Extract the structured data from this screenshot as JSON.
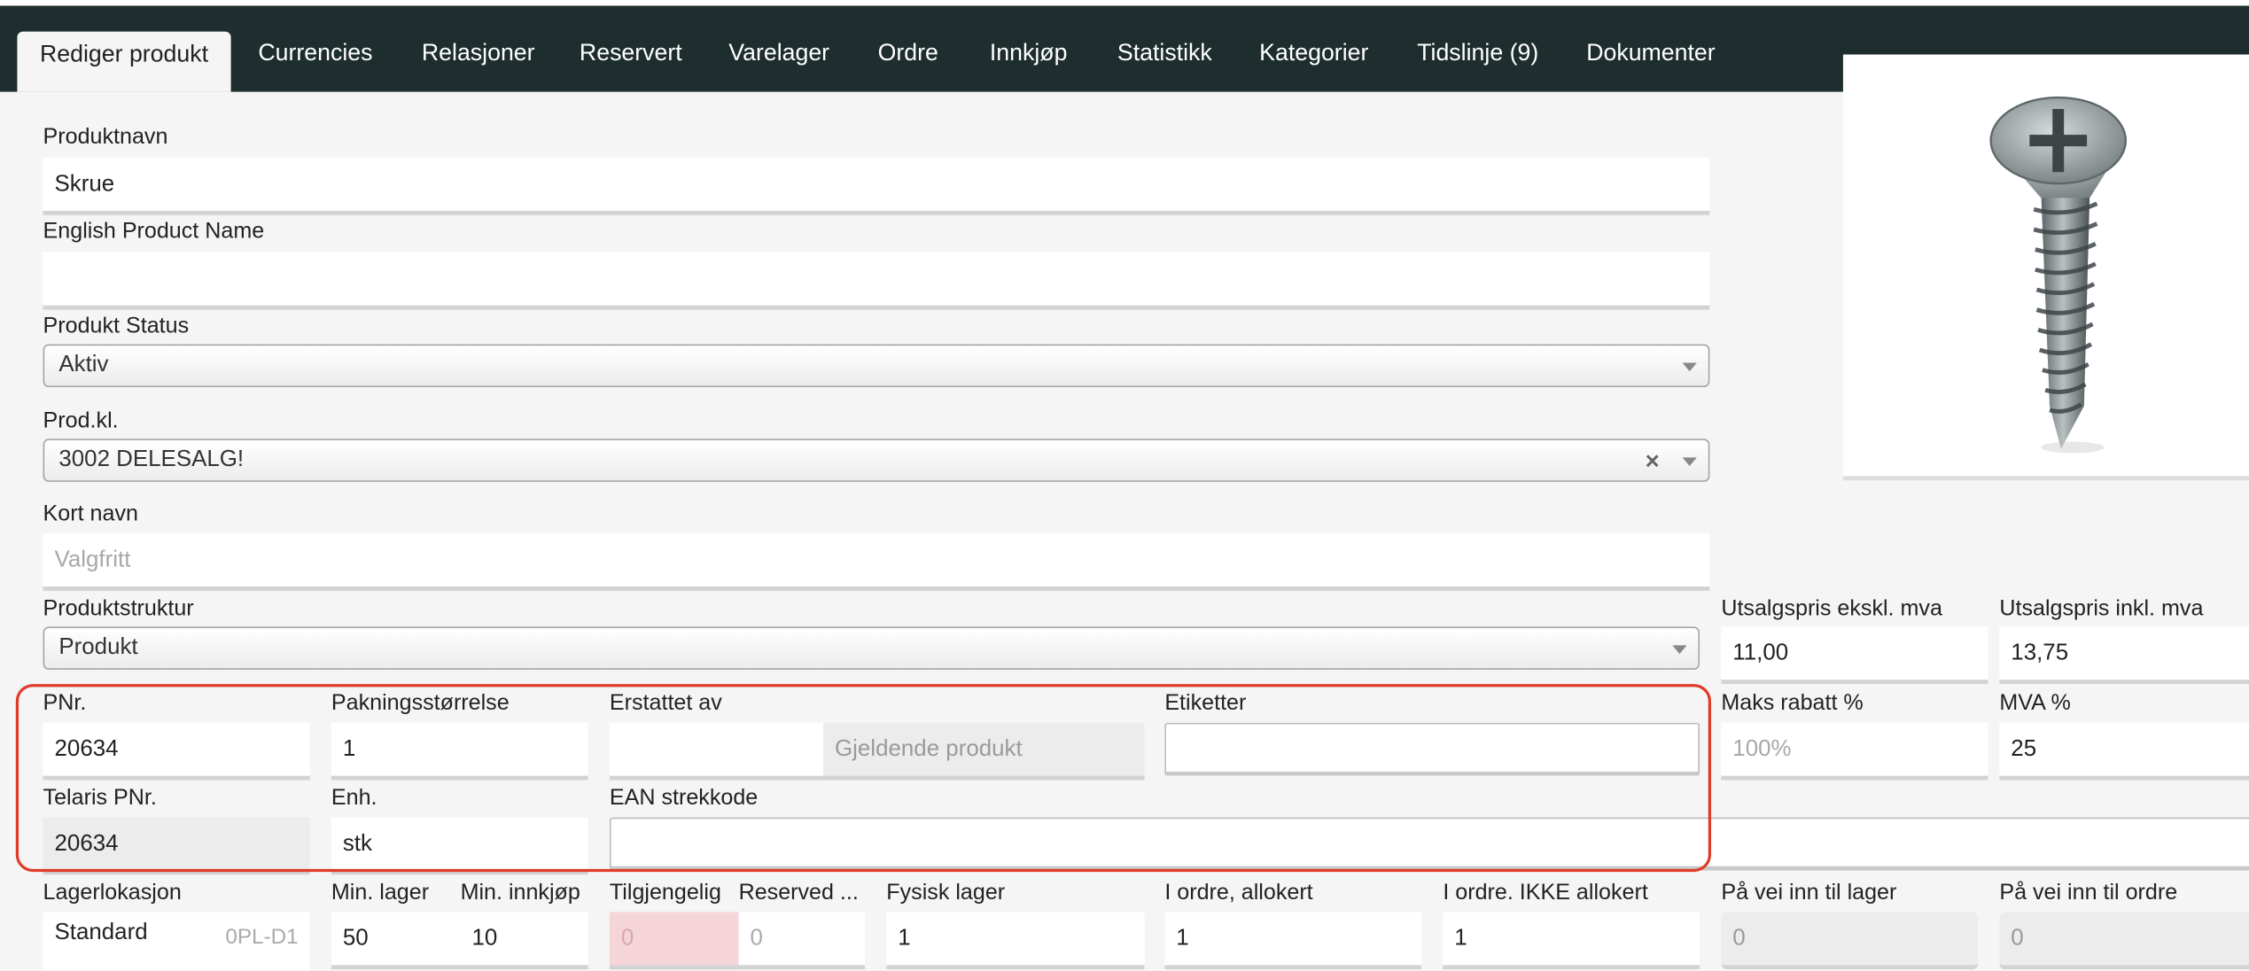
{
  "tabs": [
    {
      "label": "Rediger produkt",
      "active": true
    },
    {
      "label": "Currencies"
    },
    {
      "label": "Relasjoner"
    },
    {
      "label": "Reservert"
    },
    {
      "label": "Varelager"
    },
    {
      "label": "Ordre"
    },
    {
      "label": "Innkjøp"
    },
    {
      "label": "Statistikk"
    },
    {
      "label": "Kategorier"
    },
    {
      "label": "Tidslinje (9)"
    },
    {
      "label": "Dokumenter"
    }
  ],
  "form": {
    "produktnavn": {
      "label": "Produktnavn",
      "value": "Skrue"
    },
    "english_name": {
      "label": "English Product Name",
      "value": ""
    },
    "produkt_status": {
      "label": "Produkt Status",
      "value": "Aktiv"
    },
    "prod_kl": {
      "label": "Prod.kl.",
      "value": "3002 DELESALG!",
      "clear": "×"
    },
    "kort_navn": {
      "label": "Kort navn",
      "placeholder": "Valgfritt"
    },
    "produktstruktur": {
      "label": "Produktstruktur",
      "value": "Produkt"
    },
    "pnr": {
      "label": "PNr.",
      "value": "20634"
    },
    "pakningsstorrelse": {
      "label": "Pakningsstørrelse",
      "value": "1"
    },
    "erstattet_av": {
      "label": "Erstattet av",
      "value": "",
      "current": "Gjeldende produkt"
    },
    "etiketter": {
      "label": "Etiketter",
      "value": ""
    },
    "telaris_pnr": {
      "label": "Telaris PNr.",
      "value": "20634"
    },
    "enh": {
      "label": "Enh.",
      "value": "stk"
    },
    "ean": {
      "label": "EAN strekkode",
      "value": ""
    },
    "utsalgspris_ekskl": {
      "label": "Utsalgspris ekskl. mva",
      "value": "11,00"
    },
    "utsalgspris_inkl": {
      "label": "Utsalgspris inkl. mva",
      "value": "13,75"
    },
    "maks_rabatt": {
      "label": "Maks rabatt %",
      "placeholder": "100%"
    },
    "mva": {
      "label": "MVA %",
      "value": "25"
    },
    "lagerlokasjon": {
      "label": "Lagerlokasjon",
      "value": "Standard",
      "code": "0PL-D1"
    },
    "min_lager": {
      "label": "Min. lager",
      "value": "50"
    },
    "min_innkjop": {
      "label": "Min. innkjøp",
      "value": "10"
    },
    "tilgjengelig": {
      "label": "Tilgjengelig",
      "value": "0"
    },
    "reserved": {
      "label": "Reserved ...",
      "value": "0"
    },
    "fysisk_lager": {
      "label": "Fysisk lager",
      "value": "1"
    },
    "i_ordre_allokert": {
      "label": "I ordre, allokert",
      "value": "1"
    },
    "i_ordre_ikke": {
      "label": "I ordre. IKKE allokert",
      "value": "1"
    },
    "pa_vei_lager": {
      "label": "På vei inn til lager",
      "value": "0"
    },
    "pa_vei_ordre": {
      "label": "På vei inn til ordre",
      "value": "0"
    }
  },
  "colors": {
    "tabbar": "#1e2d2d",
    "highlight": "#e03a2a",
    "tilgjengelig_bg": "#f5d5d8"
  },
  "image": {
    "icon": "screw-icon"
  }
}
